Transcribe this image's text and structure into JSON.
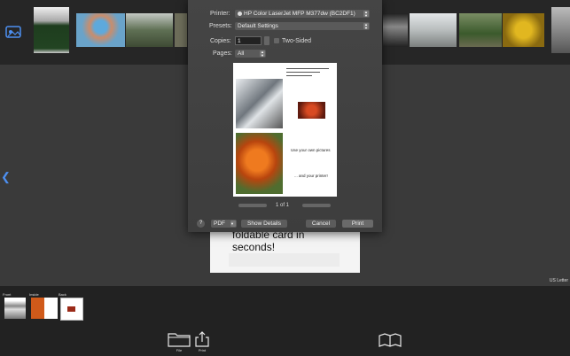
{
  "print_dialog": {
    "printer_label": "Printer:",
    "printer_value": "HP Color LaserJet MFP M377dw (BC2DF1)",
    "presets_label": "Presets:",
    "presets_value": "Default Settings",
    "copies_label": "Copies:",
    "copies_value": "1",
    "two_sided_label": "Two-Sided",
    "pages_label": "Pages:",
    "pages_value": "All",
    "page_indicator": "1 of 1",
    "help_label": "?",
    "pdf_label": "PDF",
    "show_details_label": "Show Details",
    "cancel_label": "Cancel",
    "print_label": "Print"
  },
  "preview": {
    "caption_1": "Use your own pictures",
    "caption_2": "... and your printer!"
  },
  "card": {
    "text": "foldable card in\nseconds!"
  },
  "paper_size": "US Letter",
  "page_thumbs": [
    {
      "label": "Front"
    },
    {
      "label": "Inside"
    },
    {
      "label": "Back"
    }
  ],
  "bottom_tools": [
    {
      "label": "File",
      "icon": "folder-icon"
    },
    {
      "label": "Print",
      "icon": "share-icon"
    }
  ],
  "colors": {
    "accent": "#4d8ff0",
    "background": "#1f1f1f"
  }
}
